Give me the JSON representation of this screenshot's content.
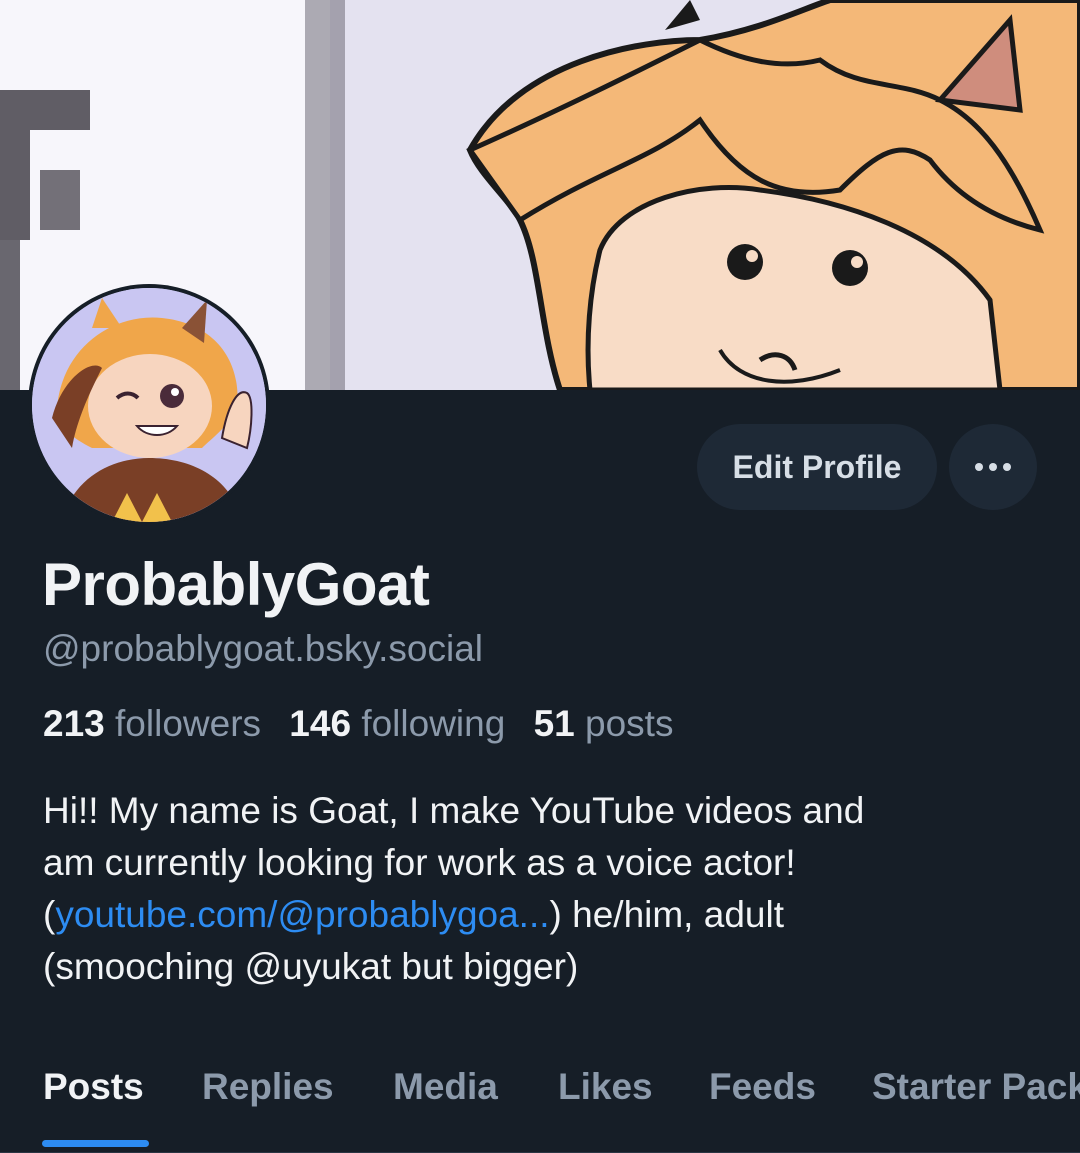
{
  "profile": {
    "display_name": "ProbablyGoat",
    "handle": "@probablygoat.bsky.social",
    "stats": {
      "followers_count": "213",
      "followers_label": "followers",
      "following_count": "146",
      "following_label": "following",
      "posts_count": "51",
      "posts_label": "posts"
    },
    "bio": {
      "line1": "Hi!! My name is Goat, I make YouTube videos and",
      "line2": "am currently looking for work as a voice actor!",
      "line3_open": "(",
      "line3_link": "youtube.com/@probablygoa...",
      "line3_rest": ") he/him, adult",
      "line4": "(smooching @uyukat but bigger)"
    }
  },
  "actions": {
    "edit_profile_label": "Edit Profile",
    "more_icon": "ellipsis-icon"
  },
  "tabs": [
    {
      "label": "Posts",
      "active": true
    },
    {
      "label": "Replies",
      "active": false
    },
    {
      "label": "Media",
      "active": false
    },
    {
      "label": "Likes",
      "active": false
    },
    {
      "label": "Feeds",
      "active": false
    },
    {
      "label": "Starter Packs",
      "active": false
    }
  ],
  "colors": {
    "background": "#161e27",
    "button_bg": "#1e2936",
    "accent_link": "#2d8cf2",
    "muted_text": "#8c9aab"
  }
}
